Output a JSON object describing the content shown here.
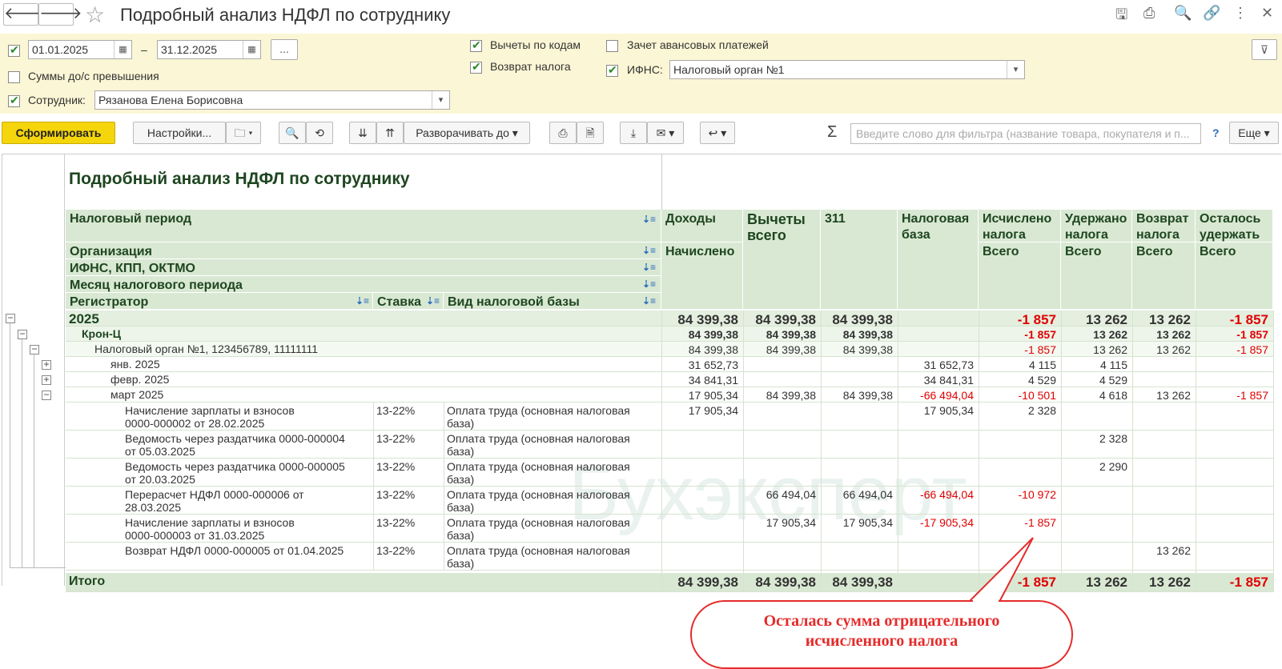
{
  "window": {
    "title": "Подробный анализ НДФЛ по сотруднику"
  },
  "filters": {
    "period_from": "01.01.2025",
    "period_dash": "–",
    "period_to": "31.12.2025",
    "period_more": "...",
    "over_limit_label": "Суммы до/с превышения",
    "employee_label": "Сотрудник:",
    "employee_value": "Рязанова Елена Борисовна",
    "deductions_by_codes_label": "Вычеты по кодам",
    "tax_refund_label": "Возврат налога",
    "advance_offset_label": "Зачет авансовых платежей",
    "ifns_label": "ИФНС:",
    "ifns_value": "Налоговый орган №1"
  },
  "toolbar": {
    "generate": "Сформировать",
    "settings": "Настройки...",
    "expand_to": "Разворачивать до",
    "search_placeholder": "Введите слово для фильтра (название товара, покупателя и п...",
    "help": "?",
    "more": "Еще"
  },
  "report": {
    "heading": "Подробный анализ НДФЛ по сотруднику",
    "left_headers": [
      "Налоговый период",
      "Организация",
      "ИФНС, КПП, ОКТМО",
      "Месяц налогового периода"
    ],
    "registrar_header": "Регистратор",
    "rate_header": "Ставка",
    "base_type_header": "Вид налоговой базы",
    "columns": [
      {
        "top": "Доходы",
        "sub": "Начислено"
      },
      {
        "top": "Вычеты всего",
        "sub": ""
      },
      {
        "top": "311",
        "sub": ""
      },
      {
        "top": "Налоговая база",
        "sub": ""
      },
      {
        "top": "Исчислено налога",
        "sub": "Всего"
      },
      {
        "top": "Удержано налога",
        "sub": "Всего"
      },
      {
        "top": "Возврат налога",
        "sub": "Всего"
      },
      {
        "top": "Осталось удержать",
        "sub": "Всего"
      }
    ],
    "rows": [
      {
        "label": "2025",
        "values": [
          "84 399,38",
          "84 399,38",
          "84 399,38",
          "",
          "-1 857",
          "13 262",
          "13 262",
          "-1 857"
        ]
      },
      {
        "label": "Крон-Ц",
        "values": [
          "84 399,38",
          "84 399,38",
          "84 399,38",
          "",
          "-1 857",
          "13 262",
          "13 262",
          "-1 857"
        ]
      },
      {
        "label": "Налоговый орган №1, 123456789, 11111111",
        "values": [
          "84 399,38",
          "84 399,38",
          "84 399,38",
          "",
          "-1 857",
          "13 262",
          "13 262",
          "-1 857"
        ]
      },
      {
        "label": "янв. 2025",
        "values": [
          "31 652,73",
          "",
          "",
          "31 652,73",
          "4 115",
          "4 115",
          "",
          ""
        ]
      },
      {
        "label": "февр. 2025",
        "values": [
          "34 841,31",
          "",
          "",
          "34 841,31",
          "4 529",
          "4 529",
          "",
          ""
        ]
      },
      {
        "label": "март 2025",
        "values": [
          "17 905,34",
          "84 399,38",
          "84 399,38",
          "-66 494,04",
          "-10 501",
          "4 618",
          "13 262",
          "-1 857"
        ]
      },
      {
        "label": "Начисление зарплаты и взносов",
        "label2": "0000-000002 от 28.02.2025",
        "rate": "13-22%",
        "base": "Оплата труда (основная налоговая",
        "base2": "база)",
        "values": [
          "17 905,34",
          "",
          "",
          "17 905,34",
          "2 328",
          "",
          "",
          ""
        ]
      },
      {
        "label": "Ведомость через раздатчика 0000-000004",
        "label2": "от 05.03.2025",
        "rate": "13-22%",
        "base": "Оплата труда (основная налоговая",
        "base2": "база)",
        "values": [
          "",
          "",
          "",
          "",
          "",
          "2 328",
          "",
          ""
        ]
      },
      {
        "label": "Ведомость через раздатчика 0000-000005",
        "label2": "от 20.03.2025",
        "rate": "13-22%",
        "base": "Оплата труда (основная налоговая",
        "base2": "база)",
        "values": [
          "",
          "",
          "",
          "",
          "",
          "2 290",
          "",
          ""
        ]
      },
      {
        "label": "Перерасчет НДФЛ 0000-000006 от",
        "label2": "28.03.2025",
        "rate": "13-22%",
        "base": "Оплата труда (основная налоговая",
        "base2": "база)",
        "values": [
          "",
          "66 494,04",
          "66 494,04",
          "-66 494,04",
          "-10 972",
          "",
          "",
          ""
        ]
      },
      {
        "label": "Начисление зарплаты и взносов",
        "label2": "0000-000003 от 31.03.2025",
        "rate": "13-22%",
        "base": "Оплата труда (основная налоговая",
        "base2": "база)",
        "values": [
          "",
          "17 905,34",
          "17 905,34",
          "-17 905,34",
          "-1 857",
          "",
          "",
          ""
        ]
      },
      {
        "label": "Возврат НДФЛ 0000-000005 от 01.04.2025",
        "label2": "",
        "rate": "13-22%",
        "base": "Оплата труда (основная налоговая",
        "base2": "база)",
        "values": [
          "",
          "",
          "",
          "",
          "",
          "",
          "13 262",
          ""
        ]
      }
    ],
    "total": {
      "label": "Итого",
      "values": [
        "84 399,38",
        "84 399,38",
        "84 399,38",
        "",
        "-1 857",
        "13 262",
        "13 262",
        "-1 857"
      ]
    },
    "watermark": "Бухэксперт"
  },
  "callout": {
    "line1": "Осталась сумма отрицательного",
    "line2": "исчисленного налога"
  },
  "colors": {
    "negative": "#e00000",
    "header_bg": "#d9e8d3",
    "filter_bg": "#fbf6d5",
    "primary_button": "#f5d50b",
    "callout": "#e52b2b"
  }
}
